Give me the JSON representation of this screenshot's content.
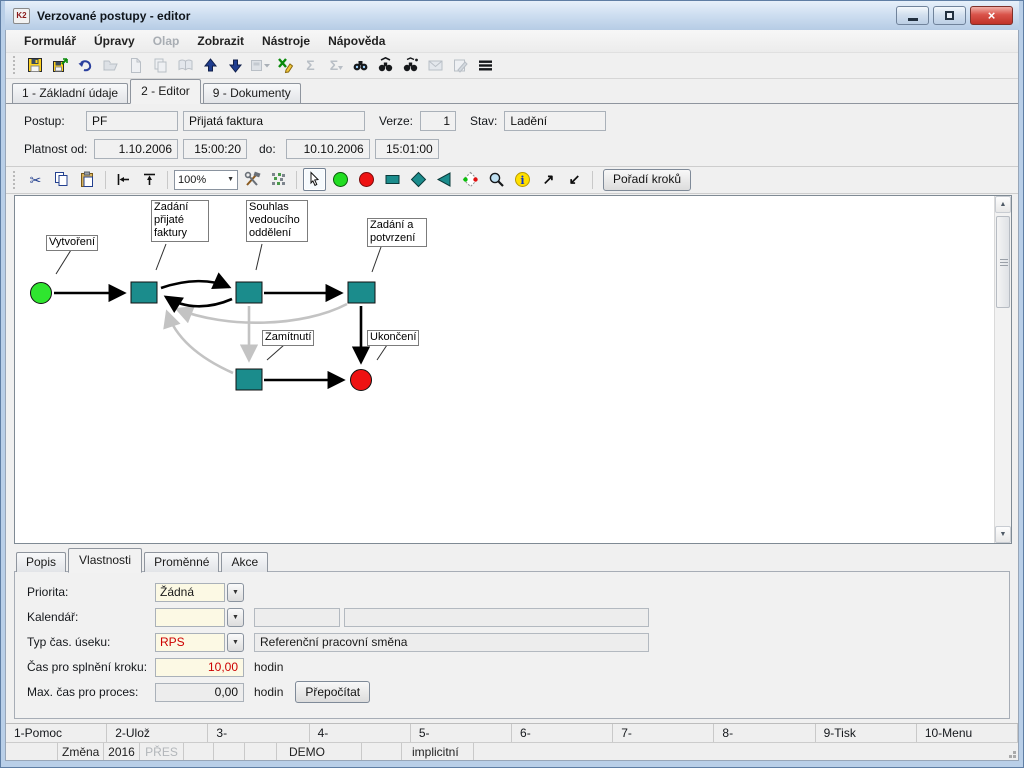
{
  "window": {
    "title": "Verzované postupy - editor",
    "icon_text": "K2"
  },
  "menu": {
    "items": [
      {
        "label": "Formulář",
        "enabled": true
      },
      {
        "label": "Úpravy",
        "enabled": true
      },
      {
        "label": "Olap",
        "enabled": false
      },
      {
        "label": "Zobrazit",
        "enabled": true
      },
      {
        "label": "Nástroje",
        "enabled": true
      },
      {
        "label": "Nápověda",
        "enabled": true
      }
    ]
  },
  "toolbar": {
    "icons": [
      "save",
      "save-version",
      "undo",
      "open",
      "new-document",
      "copy-pages",
      "book",
      "move-up",
      "move-down",
      "filter-dropdown",
      "export-edit",
      "sum",
      "sum-transfer",
      "search",
      "search-next",
      "search-special",
      "mail",
      "edit-note",
      "menu-list"
    ]
  },
  "tabs": {
    "items": [
      "1 - Základní údaje",
      "2 - Editor",
      "9 - Dokumenty"
    ],
    "active": "2 - Editor"
  },
  "form": {
    "postup_label": "Postup:",
    "postup_code": "PF",
    "postup_name": "Přijatá faktura",
    "verze_label": "Verze:",
    "verze_value": "1",
    "stav_label": "Stav:",
    "stav_value": "Ladění",
    "platnost_label": "Platnost od:",
    "od_date": "1.10.2006",
    "od_time": "15:00:20",
    "do_label": "do:",
    "do_date": "10.10.2006",
    "do_time": "15:01:00"
  },
  "editor_toolbar": {
    "tools": [
      "cut",
      "copy",
      "paste",
      "align-left",
      "align-top",
      "zoom-combo",
      "tools",
      "grid",
      "select-cursor",
      "start-node",
      "end-node",
      "step-node",
      "decision-node",
      "triangle-node",
      "condition-node",
      "zoom-lens",
      "info",
      "arrow-up-right",
      "arrow-down-left"
    ],
    "zoom_value": "100%",
    "order_button": "Pořadí kroků"
  },
  "diagram": {
    "labels": [
      {
        "text": "Vytvoření"
      },
      {
        "text": "Zadání\npřijaté\nfaktury"
      },
      {
        "text": "Souhlas\nvedoucího\noddělení"
      },
      {
        "text": "Zadání a\npotvrzení"
      },
      {
        "text": "Zamítnutí"
      },
      {
        "text": "Ukončení"
      }
    ],
    "nodes": [
      {
        "id": "start",
        "shape": "circle",
        "color": "#2fe52f",
        "label": "Vytvoření"
      },
      {
        "id": "step1",
        "shape": "rect",
        "color": "#1b8c8c",
        "label": "Zadání přijaté faktury"
      },
      {
        "id": "step2",
        "shape": "rect",
        "color": "#1b8c8c",
        "label": "Souhlas vedoucího oddělení"
      },
      {
        "id": "step3",
        "shape": "rect",
        "color": "#1b8c8c",
        "label": "Zadání a potvrzení"
      },
      {
        "id": "step4",
        "shape": "rect",
        "color": "#1b8c8c",
        "label": "Zamítnutí"
      },
      {
        "id": "end",
        "shape": "circle",
        "color": "#ee1212",
        "label": "Ukončení"
      }
    ],
    "edges": [
      {
        "from": "start",
        "to": "step1",
        "color": "black"
      },
      {
        "from": "step1",
        "to": "step2",
        "color": "black"
      },
      {
        "from": "step2",
        "to": "step1",
        "color": "black"
      },
      {
        "from": "step2",
        "to": "step3",
        "color": "black"
      },
      {
        "from": "step3",
        "to": "end",
        "color": "black"
      },
      {
        "from": "step4",
        "to": "end",
        "color": "black"
      },
      {
        "from": "step2",
        "to": "step4",
        "color": "gray"
      },
      {
        "from": "step3",
        "to": "step1",
        "color": "gray"
      },
      {
        "from": "step4",
        "to": "step1",
        "color": "gray"
      }
    ],
    "colors": {
      "edge_gray": "#c3c3c3",
      "edge_black": "#000000"
    }
  },
  "panel": {
    "tabs": [
      "Popis",
      "Vlastnosti",
      "Proměnné",
      "Akce"
    ],
    "active": "Vlastnosti",
    "fields": {
      "priorita_label": "Priorita:",
      "priorita_value": "Žádná",
      "kalendar_label": "Kalendář:",
      "kalendar_value": "",
      "kalendar_code": "",
      "kalendar_desc": "",
      "typ_label": "Typ čas. úseku:",
      "typ_value": "RPS",
      "typ_desc": "Referenční pracovní směna",
      "cas_label": "Čas pro splnění kroku:",
      "cas_value": "10,00",
      "cas_unit": "hodin",
      "max_label": "Max. čas pro proces:",
      "max_value": "0,00",
      "max_unit": "hodin",
      "recalc_button": "Přepočítat"
    },
    "colors": {
      "editable_bg": "#fcf9e4",
      "readonly_bg": "#ededed",
      "highlight_text": "#cc0000"
    }
  },
  "fkeys": [
    "1-Pomoc",
    "2-Ulož",
    "3-",
    "4-",
    "5-",
    "6-",
    "7-",
    "8-",
    "9-Tisk",
    "10-Menu"
  ],
  "status": {
    "cells": [
      "",
      "Změna",
      "2016",
      "PŘES",
      "",
      "",
      "",
      "DEMO",
      "",
      "implicitní",
      ""
    ]
  }
}
